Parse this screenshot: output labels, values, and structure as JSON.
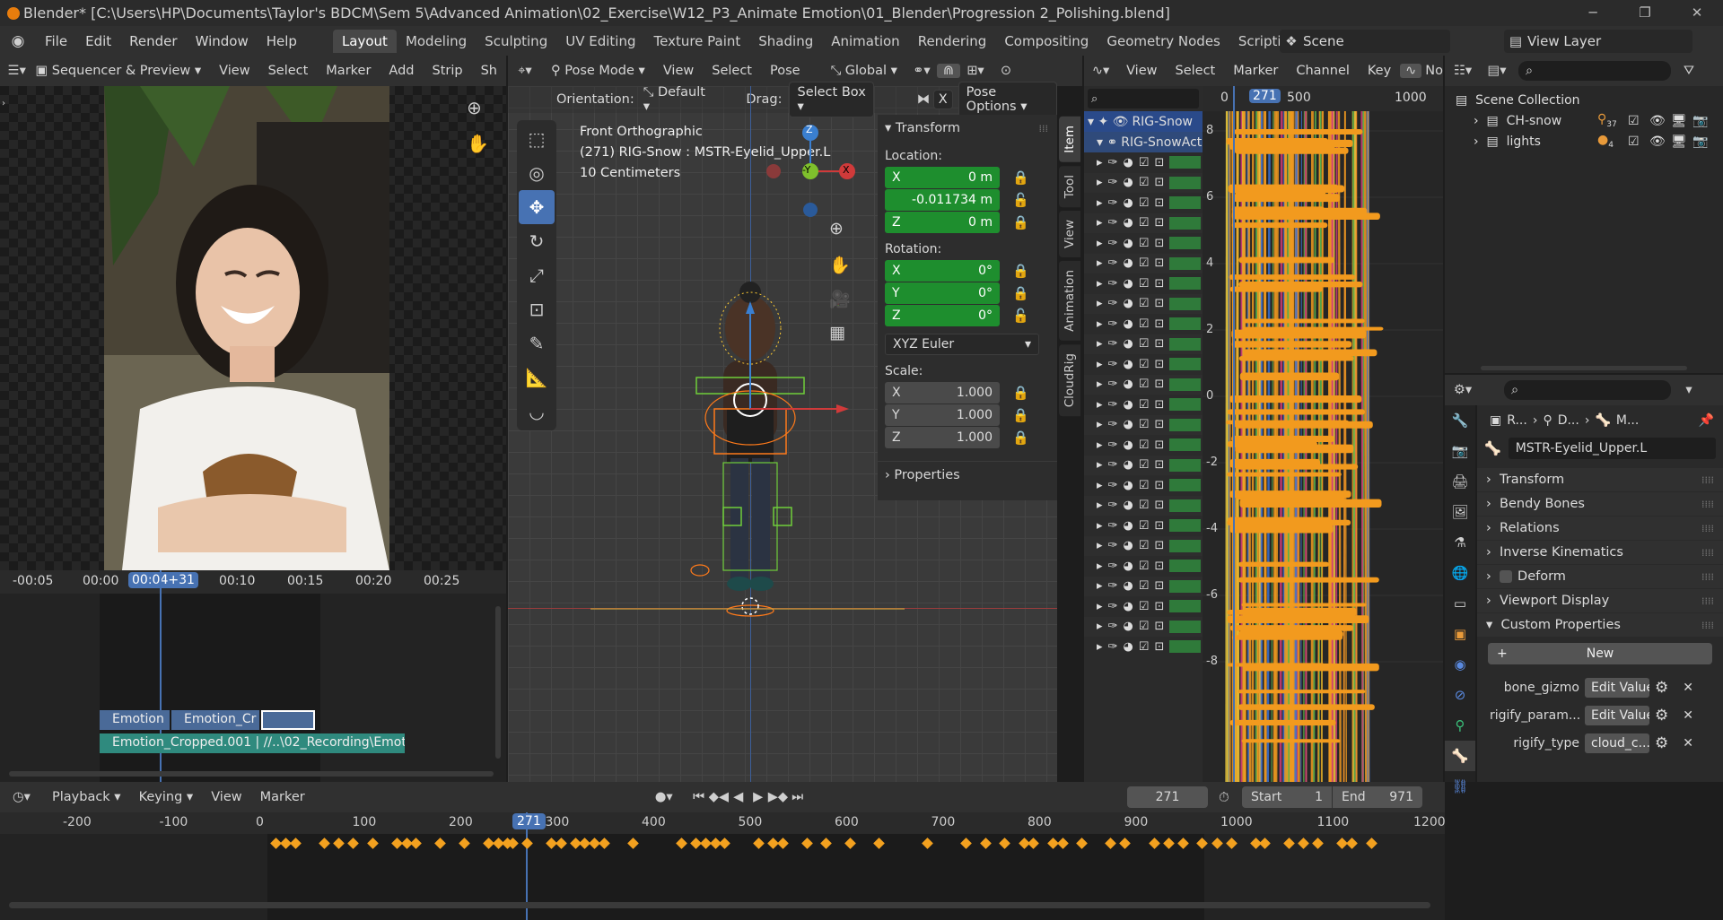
{
  "title_bar": {
    "title": "Blender* [C:\\Users\\HP\\Documents\\Taylor's BDCM\\Sem 5\\Advanced Animation\\02_Exercise\\W12_P3_Animate Emotion\\01_Blender\\Progression 2_Polishing.blend]"
  },
  "menu": [
    "File",
    "Edit",
    "Render",
    "Window",
    "Help"
  ],
  "workspaces": [
    "Layout",
    "Modeling",
    "Sculpting",
    "UV Editing",
    "Texture Paint",
    "Shading",
    "Animation",
    "Rendering",
    "Compositing",
    "Geometry Nodes",
    "Scripting"
  ],
  "scene": {
    "name": "Scene",
    "view_layer": "View Layer"
  },
  "sequencer": {
    "mode": "Sequencer & Preview",
    "menus": [
      "View",
      "Select",
      "Marker",
      "Add",
      "Strip",
      "Sh"
    ],
    "ruler": [
      "-00:05",
      "00:00",
      "00:04+31",
      "00:10",
      "00:15",
      "00:20",
      "00:25"
    ],
    "strips": {
      "strip1": "Emotion",
      "strip2": "Emotion_Cr",
      "strip3": "Emotion_Cropped.001 | //..\\02_Recording\\Emotio"
    }
  },
  "viewport": {
    "mode": "Pose Mode",
    "menus": [
      "View",
      "Select",
      "Pose"
    ],
    "transform_orientation": "Global",
    "orientation_label": "Orientation:",
    "orientation_value": "Default",
    "drag_label": "Drag:",
    "drag_value": "Select Box",
    "pose_options": "Pose Options",
    "x_toggle": "X",
    "overlay_line1": "Front Orthographic",
    "overlay_line2": "(271) RIG-Snow : MSTR-Eyelid_Upper.L",
    "overlay_line3": "10 Centimeters",
    "gizmo_z": "Z",
    "gizmo_y": "-Y",
    "gizmo_x": "X"
  },
  "npanel": {
    "tabs": [
      "Item",
      "Tool",
      "View",
      "Animation",
      "CloudRig"
    ],
    "transform_title": "Transform",
    "location_label": "Location:",
    "location": {
      "x": "0 m",
      "y": "-0.011734 m",
      "z": "0 m"
    },
    "rotation_label": "Rotation:",
    "rotation": {
      "x": "0°",
      "y": "0°",
      "z": "0°"
    },
    "rotation_mode": "XYZ Euler",
    "scale_label": "Scale:",
    "scale": {
      "x": "1.000",
      "y": "1.000",
      "z": "1.000"
    },
    "properties": "Properties",
    "axis": {
      "x": "X",
      "y": "Y",
      "z": "Z"
    }
  },
  "graph": {
    "menus": [
      "View",
      "Select",
      "Marker",
      "Channel",
      "Key"
    ],
    "rig_name": "RIG-Snow",
    "action_name": "RIG-SnowAct",
    "frame_ticks": [
      "0",
      "271",
      "500",
      "1000"
    ],
    "y_ticks": [
      "8",
      "6",
      "4",
      "2",
      "0",
      "-2",
      "-4",
      "-6",
      "-8"
    ],
    "extra": "No"
  },
  "outliner": {
    "root": "Scene Collection",
    "items": [
      {
        "name": "CH-snow",
        "badge": "37"
      },
      {
        "name": "lights",
        "badge": "4"
      }
    ]
  },
  "properties": {
    "breadcrumb": [
      "R...",
      "D...",
      "M..."
    ],
    "bone_name": "MSTR-Eyelid_Upper.L",
    "sections": [
      "Transform",
      "Bendy Bones",
      "Relations",
      "Inverse Kinematics",
      "Deform",
      "Viewport Display",
      "Custom Properties"
    ],
    "new_button": "New",
    "custom_props": [
      {
        "name": "bone_gizmo",
        "value": "Edit Value"
      },
      {
        "name": "rigify_param...",
        "value": "Edit Value"
      },
      {
        "name": "rigify_type",
        "value": "cloud_c..."
      }
    ]
  },
  "timeline": {
    "menus": [
      "Playback",
      "Keying",
      "View",
      "Marker"
    ],
    "current_frame": "271",
    "start_label": "Start",
    "start": "1",
    "end_label": "End",
    "end": "971",
    "ticks": [
      "-200",
      "-100",
      "0",
      "100",
      "200",
      "300",
      "400",
      "500",
      "600",
      "700",
      "800",
      "900",
      "1000",
      "1100",
      "1200"
    ]
  },
  "colors": {
    "accent": "#4772b3",
    "green_field": "#1e8e2e",
    "keyframe": "#f3a11f"
  }
}
